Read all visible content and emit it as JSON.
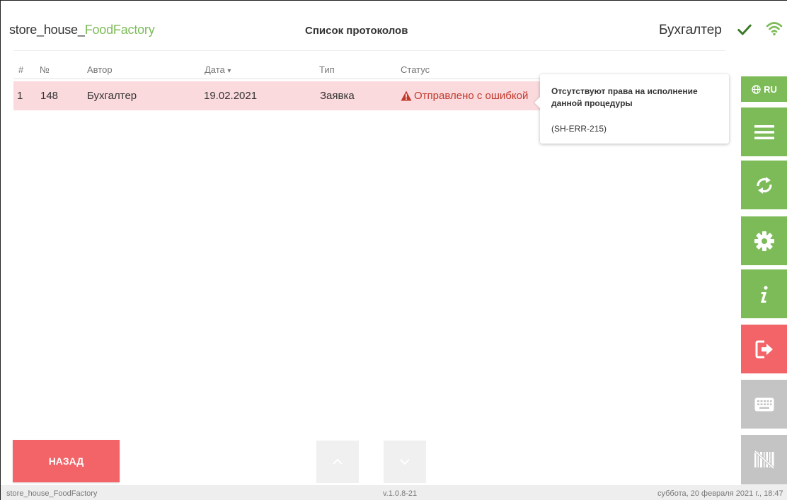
{
  "header": {
    "app_name_prefix": "store_house_",
    "app_name_brand": "FoodFactory",
    "page_title": "Список протоколов",
    "user_name": "Бухгалтер",
    "brand_color": "#7cbb58"
  },
  "table": {
    "columns": {
      "index": "#",
      "number": "№",
      "author": "Автор",
      "date": "Дата",
      "date_sort_indicator": "▾",
      "type": "Тип",
      "status": "Статус"
    },
    "rows": [
      {
        "index": "1",
        "number": "148",
        "author": "Бухгалтер",
        "date": "19.02.2021",
        "type": "Заявка",
        "status": "Отправлено с ошибкой",
        "status_icon": "warning-triangle-icon"
      }
    ]
  },
  "tooltip": {
    "message": "Отсутствуют права на исполнение данной процедуры",
    "code": "(SH-ERR-215)"
  },
  "sidebar": {
    "language_label": "RU",
    "buttons": [
      "globe-icon",
      "menu-icon",
      "sync-icon",
      "gear-icon",
      "info-icon",
      "exit-icon",
      "keyboard-icon",
      "barcode-off-icon"
    ]
  },
  "bottom": {
    "back_label": "НАЗАД"
  },
  "footer": {
    "app_name": "store_house_FoodFactory",
    "version": "v.1.0.8-21",
    "datetime": "суббота, 20 февраля 2021 г., 18:47"
  },
  "colors": {
    "accent_green": "#7cbb58",
    "danger_red": "#f26468",
    "error_row": "#fbdadd",
    "disabled_gray": "#c4c4c4"
  }
}
